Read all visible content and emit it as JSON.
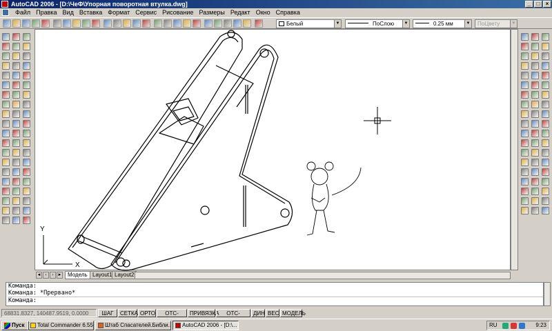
{
  "window": {
    "title": "AutoCAD 2006 - [D:\\ЧеФ\\Упорная поворотная втулка.dwg]"
  },
  "menu": {
    "items": [
      "Файл",
      "Правка",
      "Вид",
      "Вставка",
      "Формат",
      "Сервис",
      "Рисование",
      "Размеры",
      "Редакт",
      "Окно",
      "Справка"
    ]
  },
  "toolbar": {
    "layer_color": "Белый",
    "linetype": "ПоСлою",
    "lineweight": "0.25 мм",
    "plotstyle": "ПоЦвету"
  },
  "drawing": {
    "ucs": {
      "y_label": "Y",
      "x_label": "X"
    }
  },
  "tabs": [
    "Модель",
    "Layout1",
    "Layout2"
  ],
  "command": {
    "lines": [
      "Команда:",
      "Команда: *Прервано*",
      "Команда:"
    ]
  },
  "status": {
    "coordinates": "68831.8327, 140487.9519, 0.0000",
    "buttons": [
      "ШАГ",
      "СЕТКА",
      "ОРТО",
      "ОТС-ПОЛЯР",
      "ПРИВЯЗКА",
      "ОТС-ОБЪЕКТ",
      "ДИН",
      "ВЕС",
      "МОДЕЛЬ"
    ]
  },
  "taskbar": {
    "start": "Пуск",
    "tasks": [
      "Total Commander 6.55 ру...",
      "Штаб Спасателей.Библи...",
      "AutoCAD 2006 - [D:\\..."
    ],
    "lang": "RU",
    "clock": "9:23"
  },
  "colors": {
    "title_start": "#0a246a",
    "title_end": "#3a6ea5",
    "face": "#d4d0c8",
    "canvas": "#ffffff"
  }
}
